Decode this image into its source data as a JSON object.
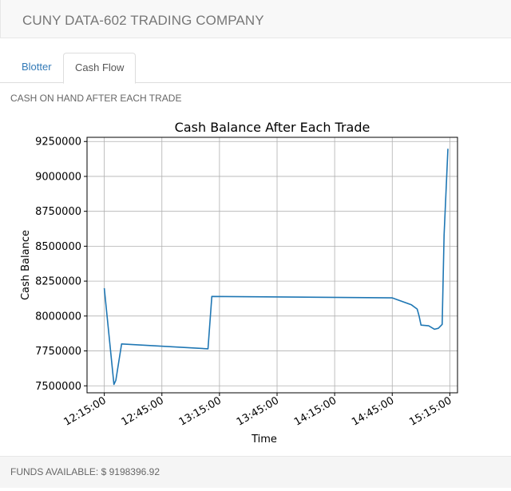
{
  "app": {
    "title": "CUNY DATA-602 TRADING COMPANY"
  },
  "tabs": [
    {
      "label": "Blotter",
      "active": false
    },
    {
      "label": "Cash Flow",
      "active": true
    }
  ],
  "section_label": "CASH ON HAND AFTER EACH TRADE",
  "footer": {
    "funds_label": "FUNDS AVAILABLE: $ 9198396.92"
  },
  "colors": {
    "line": "#1f77b4",
    "link": "#337ab7"
  },
  "chart_data": {
    "type": "line",
    "title": "Cash Balance After Each Trade",
    "xlabel": "Time",
    "ylabel": "Cash Balance",
    "ylim": [
      7450000,
      9280000
    ],
    "y_ticks": [
      7500000,
      7750000,
      8000000,
      8250000,
      8500000,
      8750000,
      9000000,
      9250000
    ],
    "y_tick_labels": [
      "7500000",
      "7750000",
      "8000000",
      "8250000",
      "8500000",
      "8750000",
      "9000000",
      "9250000"
    ],
    "x_ticks": [
      "12:15:00",
      "12:45:00",
      "13:15:00",
      "13:45:00",
      "14:15:00",
      "14:45:00",
      "15:15:00"
    ],
    "grid": true,
    "series": [
      {
        "x": [
          "12:15:00",
          "12:20:00",
          "12:21:00",
          "12:24:00",
          "13:09:00",
          "13:11:00",
          "14:45:00",
          "14:55:00",
          "14:58:00",
          "14:59:00",
          "15:00:00",
          "15:04:00",
          "15:07:00",
          "15:09:00",
          "15:11:00",
          "15:12:00",
          "15:14:00"
        ],
        "y": [
          8200000,
          7510000,
          7540000,
          7800000,
          7765000,
          8140000,
          8130000,
          8080000,
          8050000,
          8000000,
          7935000,
          7930000,
          7905000,
          7912000,
          7940000,
          8580000,
          9198396.92
        ]
      }
    ]
  }
}
